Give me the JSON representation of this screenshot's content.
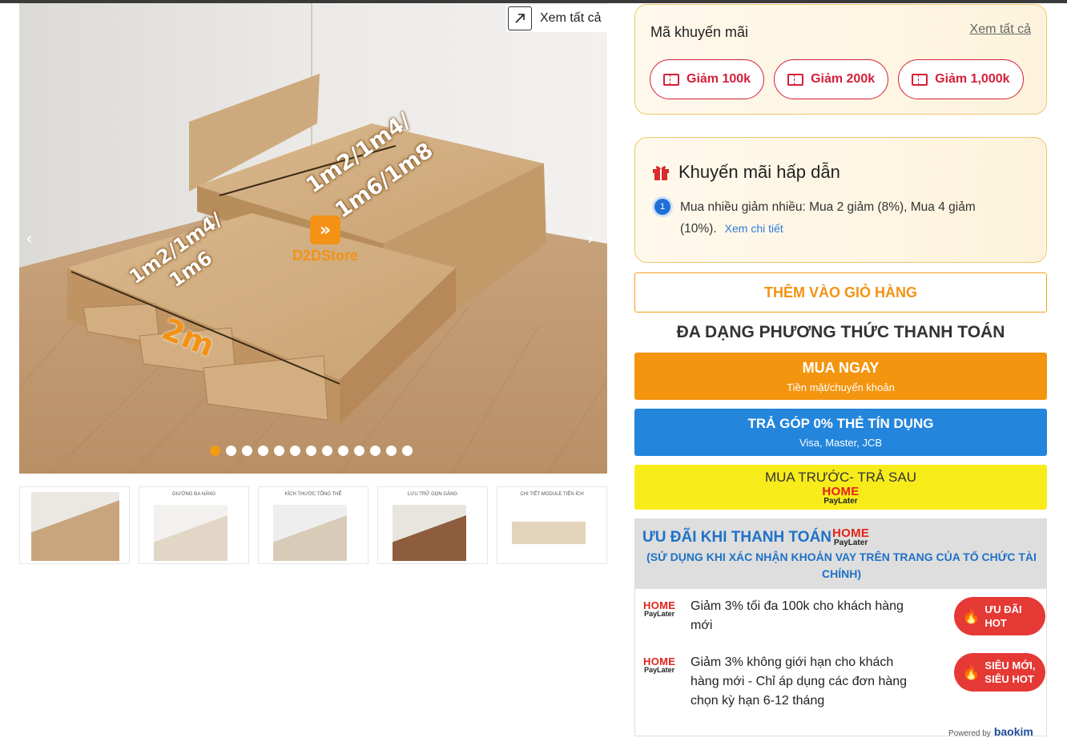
{
  "gallery": {
    "view_all": "Xem tất cả",
    "dims": {
      "upper": "1m2/1m4/",
      "upper2": "1m6/1m8",
      "lower": "1m2/1m4/",
      "lower2": "1m6",
      "length": "2m"
    },
    "store_name": "D2DStore",
    "slide_count": 13,
    "active_slide": 0,
    "thumbnails": [
      {
        "caption": ""
      },
      {
        "caption": "GIƯỜNG ĐA NĂNG"
      },
      {
        "caption": "KÍCH THƯỚC TỔNG THỂ"
      },
      {
        "caption": "LƯU TRỮ GỌN GÀNG"
      },
      {
        "caption": "CHI TIẾT MODULE TIỆN ÍCH"
      }
    ]
  },
  "promo": {
    "title": "Mã khuyến mãi",
    "view_all": "Xem tất cả",
    "coupons": [
      "Giảm 100k",
      "Giảm 200k",
      "Giảm 1,000k"
    ]
  },
  "offer": {
    "title": "Khuyến mãi hấp dẫn",
    "index": "1",
    "text": "Mua nhiều giảm nhiều: Mua 2 giảm (8%), Mua 4 giảm (10%).",
    "link": "Xem chi tiết"
  },
  "add_to_cart": "THÊM VÀO GIỎ HÀNG",
  "payment_title": "ĐA DẠNG PHƯƠNG THỨC THANH TOÁN",
  "buy_now": {
    "label": "MUA NGAY",
    "sub": "Tiền mặt/chuyển khoản"
  },
  "installment": {
    "label": "TRẢ GÓP 0% THẺ TÍN DỤNG",
    "sub": "Visa, Master, JCB"
  },
  "paylater": {
    "label": "MUA TRƯỚC- TRẢ SAU",
    "brand_top": "HOME",
    "brand_bottom": "PayLater"
  },
  "deal": {
    "title": "ƯU ĐÃI KHI THANH TOÁN",
    "note": "(SỬ DỤNG KHI XÁC NHẬN KHOẢN VAY TRÊN TRANG CỦA TỔ CHỨC TÀI CHÍNH)",
    "items": [
      {
        "text": "Giảm 3% tối đa 100k cho khách hàng mới",
        "badge": "ƯU ĐÃI HOT"
      },
      {
        "text": "Giảm 3% không giới hạn cho khách hàng mới - Chỉ áp dụng các đơn hàng chọn kỳ hạn 6-12 tháng",
        "badge": "SIÊU MỚI, SIÊU HOT"
      }
    ],
    "powered_by": "Powered by",
    "powered_brand": "baokim"
  },
  "colors": {
    "accent_orange": "#f4950f",
    "blue": "#2385dc",
    "yellow": "#f7ec1a",
    "red": "#e53935",
    "coupon_red": "#d51f3a"
  }
}
